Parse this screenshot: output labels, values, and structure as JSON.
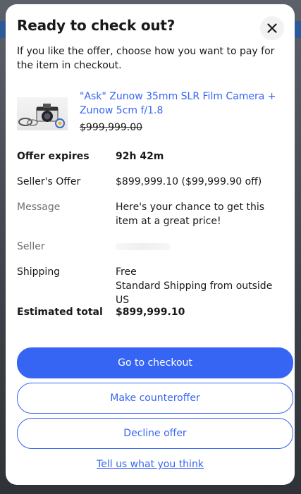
{
  "modal": {
    "title": "Ready to check out?",
    "intro": "If you like the offer, choose how you want to pay for the item in checkout."
  },
  "item": {
    "title": "\"Ask\" Zunow 35mm SLR Film Camera + Zunow 5cm f/1.8",
    "original_price": "$999,999.00"
  },
  "details": [
    {
      "label": "Offer expires",
      "value": "92h 42m",
      "bold": true,
      "muted": false
    },
    {
      "label": "Seller's Offer",
      "value": "$899,999.10 ($99,999.90 off)",
      "bold": false,
      "muted": false
    },
    {
      "label": "Message",
      "value": "Here's your chance to get this item at a great price!",
      "bold": false,
      "muted": true
    },
    {
      "label": "Seller",
      "value": "",
      "bold": false,
      "muted": true
    },
    {
      "label": "Shipping",
      "value": "Free",
      "value2": "Standard Shipping from outside US",
      "bold": false,
      "muted": false
    },
    {
      "label": "Estimated total",
      "value": "$899,999.10",
      "bold": true,
      "muted": false
    }
  ],
  "buttons": {
    "checkout": "Go to checkout",
    "counteroffer": "Make counteroffer",
    "decline": "Decline offer"
  },
  "feedback_link": "Tell us what you think",
  "colors": {
    "primary": "#3665f3",
    "text": "#191919",
    "muted": "#707070"
  }
}
